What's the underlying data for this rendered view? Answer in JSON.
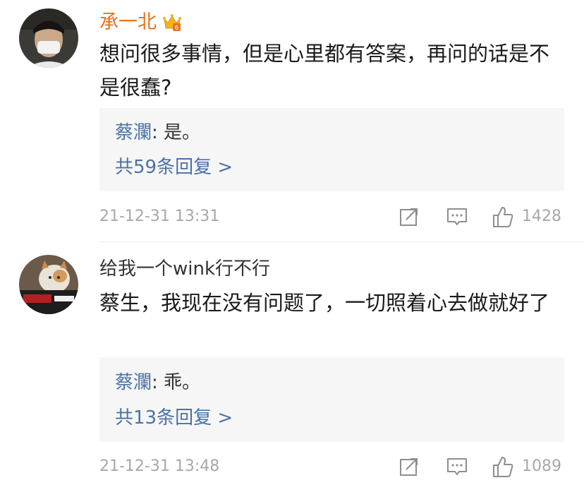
{
  "comments": [
    {
      "username": "承一北",
      "username_color": "#e8711d",
      "has_vip_badge": true,
      "body": "想问很多事情，但是心里都有答案，再问的话是不是很蠢?",
      "reply_author": "蔡瀾",
      "reply_separator": ": ",
      "reply_text": "是。",
      "more_replies": "共59条回复 >",
      "timestamp": "21-12-31 13:31",
      "likes": "1428"
    },
    {
      "username": "给我一个wink行不行",
      "username_color": "#333333",
      "has_vip_badge": false,
      "body": "蔡生，我现在没有问题了，一切照着心去做就好了",
      "reply_author": "蔡瀾",
      "reply_separator": ": ",
      "reply_text": "乖。",
      "more_replies": "共13条回复 >",
      "timestamp": "21-12-31 13:48",
      "likes": "1089"
    }
  ],
  "colors": {
    "link_blue": "#4a72a6",
    "meta_gray": "#a8a8a8",
    "reply_bg": "#f6f6f6"
  },
  "icons": [
    "avatar-icon",
    "vip-crown-icon",
    "share-icon",
    "comment-icon",
    "like-icon"
  ]
}
